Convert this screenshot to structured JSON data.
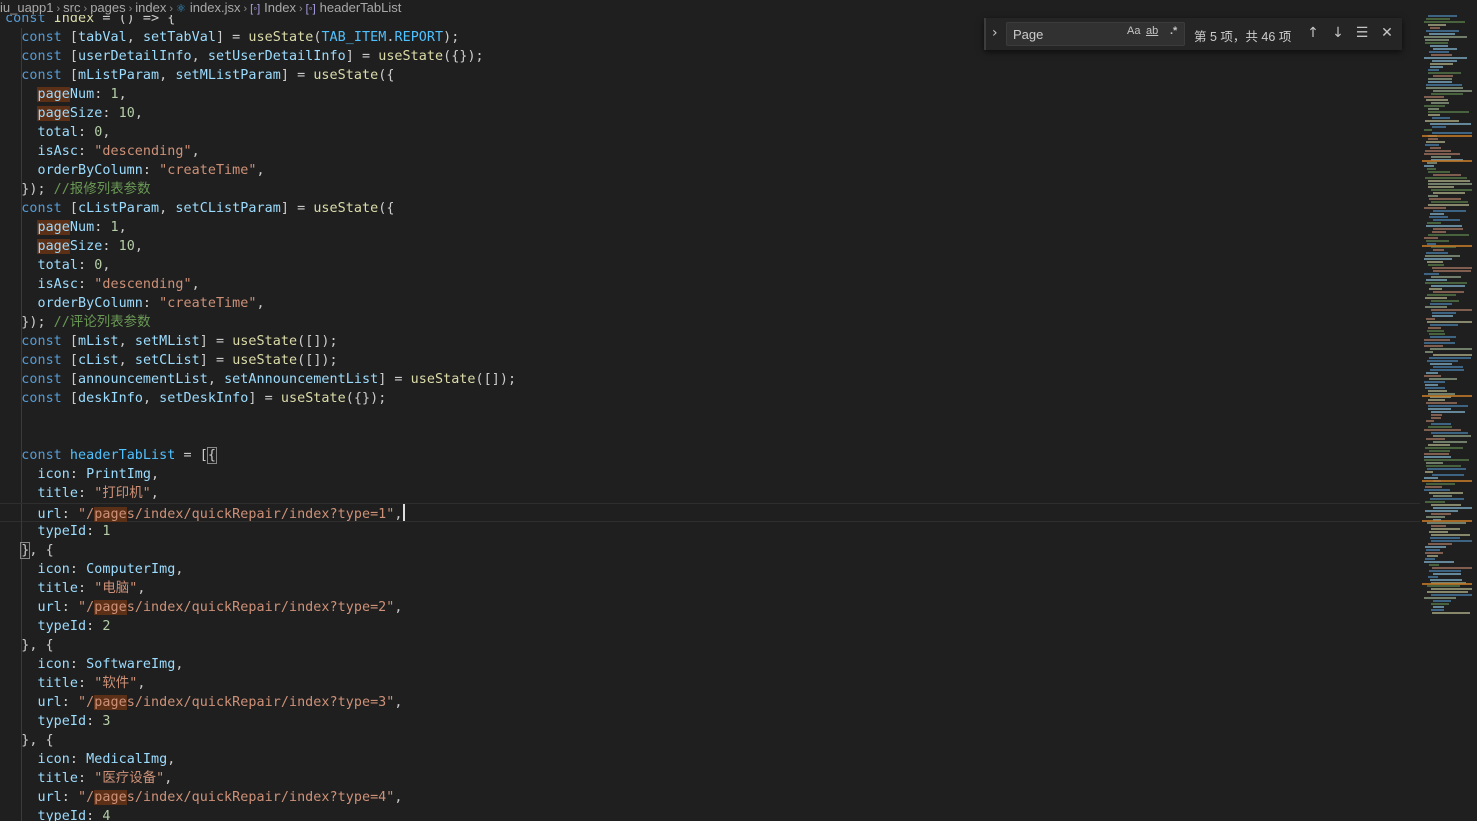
{
  "breadcrumb": {
    "items": [
      "iu_uapp1",
      "src",
      "pages",
      "index",
      "index.jsx",
      "Index",
      "headerTabList"
    ]
  },
  "find_widget": {
    "query": "Page",
    "match_case_label": "Aa",
    "whole_word_label": "ab",
    "regex_label": ".*",
    "count": "第 5 项，共 46 项"
  },
  "colors": {
    "background": "#1f1f1f",
    "keyword": "#569cd6",
    "variable": "#9cdcfe",
    "function": "#dcdcaa",
    "constant": "#4fc1ff",
    "string": "#ce9178",
    "number": "#b5cea8",
    "comment": "#6a9955",
    "match_highlight": "#5c2f17"
  },
  "code": {
    "lines": [
      [
        [
          "k",
          "const "
        ],
        [
          "f",
          "Index"
        ],
        [
          "p",
          " = () => {"
        ]
      ],
      [
        [
          "p",
          "  "
        ],
        [
          "k",
          "const "
        ],
        [
          "p",
          "["
        ],
        [
          "v",
          "tabVal"
        ],
        [
          "p",
          ", "
        ],
        [
          "v",
          "setTabVal"
        ],
        [
          "p",
          "] = "
        ],
        [
          "f",
          "useState"
        ],
        [
          "p",
          "("
        ],
        [
          "c",
          "TAB_ITEM"
        ],
        [
          "p",
          "."
        ],
        [
          "c",
          "REPORT"
        ],
        [
          "p",
          ");"
        ]
      ],
      [
        [
          "p",
          "  "
        ],
        [
          "k",
          "const "
        ],
        [
          "p",
          "["
        ],
        [
          "v",
          "userDetailInfo"
        ],
        [
          "p",
          ", "
        ],
        [
          "v",
          "setUserDetailInfo"
        ],
        [
          "p",
          "] = "
        ],
        [
          "f",
          "useState"
        ],
        [
          "p",
          "({});"
        ]
      ],
      [
        [
          "p",
          "  "
        ],
        [
          "k",
          "const "
        ],
        [
          "p",
          "["
        ],
        [
          "v",
          "mListParam"
        ],
        [
          "p",
          ", "
        ],
        [
          "v",
          "setMListParam"
        ],
        [
          "p",
          "] = "
        ],
        [
          "f",
          "useState"
        ],
        [
          "p",
          "({"
        ]
      ],
      [
        [
          "p",
          "    "
        ],
        [
          "hv",
          "page"
        ],
        [
          "v",
          "Num"
        ],
        [
          "p",
          ": "
        ],
        [
          "n",
          "1"
        ],
        [
          "p",
          ","
        ]
      ],
      [
        [
          "p",
          "    "
        ],
        [
          "hv",
          "page"
        ],
        [
          "v",
          "Size"
        ],
        [
          "p",
          ": "
        ],
        [
          "n",
          "10"
        ],
        [
          "p",
          ","
        ]
      ],
      [
        [
          "p",
          "    "
        ],
        [
          "v",
          "total"
        ],
        [
          "p",
          ": "
        ],
        [
          "n",
          "0"
        ],
        [
          "p",
          ","
        ]
      ],
      [
        [
          "p",
          "    "
        ],
        [
          "v",
          "isAsc"
        ],
        [
          "p",
          ": "
        ],
        [
          "s",
          "\"descending\""
        ],
        [
          "p",
          ","
        ]
      ],
      [
        [
          "p",
          "    "
        ],
        [
          "v",
          "orderByColumn"
        ],
        [
          "p",
          ": "
        ],
        [
          "s",
          "\"createTime\""
        ],
        [
          "p",
          ","
        ]
      ],
      [
        [
          "p",
          "  }); "
        ],
        [
          "cm",
          "//报修列表参数"
        ]
      ],
      [
        [
          "p",
          "  "
        ],
        [
          "k",
          "const "
        ],
        [
          "p",
          "["
        ],
        [
          "v",
          "cListParam"
        ],
        [
          "p",
          ", "
        ],
        [
          "v",
          "setCListParam"
        ],
        [
          "p",
          "] = "
        ],
        [
          "f",
          "useState"
        ],
        [
          "p",
          "({"
        ]
      ],
      [
        [
          "p",
          "    "
        ],
        [
          "hv",
          "page"
        ],
        [
          "v",
          "Num"
        ],
        [
          "p",
          ": "
        ],
        [
          "n",
          "1"
        ],
        [
          "p",
          ","
        ]
      ],
      [
        [
          "p",
          "    "
        ],
        [
          "hv",
          "page"
        ],
        [
          "v",
          "Size"
        ],
        [
          "p",
          ": "
        ],
        [
          "n",
          "10"
        ],
        [
          "p",
          ","
        ]
      ],
      [
        [
          "p",
          "    "
        ],
        [
          "v",
          "total"
        ],
        [
          "p",
          ": "
        ],
        [
          "n",
          "0"
        ],
        [
          "p",
          ","
        ]
      ],
      [
        [
          "p",
          "    "
        ],
        [
          "v",
          "isAsc"
        ],
        [
          "p",
          ": "
        ],
        [
          "s",
          "\"descending\""
        ],
        [
          "p",
          ","
        ]
      ],
      [
        [
          "p",
          "    "
        ],
        [
          "v",
          "orderByColumn"
        ],
        [
          "p",
          ": "
        ],
        [
          "s",
          "\"createTime\""
        ],
        [
          "p",
          ","
        ]
      ],
      [
        [
          "p",
          "  }); "
        ],
        [
          "cm",
          "//评论列表参数"
        ]
      ],
      [
        [
          "p",
          "  "
        ],
        [
          "k",
          "const "
        ],
        [
          "p",
          "["
        ],
        [
          "v",
          "mList"
        ],
        [
          "p",
          ", "
        ],
        [
          "v",
          "setMList"
        ],
        [
          "p",
          "] = "
        ],
        [
          "f",
          "useState"
        ],
        [
          "p",
          "([]);"
        ]
      ],
      [
        [
          "p",
          "  "
        ],
        [
          "k",
          "const "
        ],
        [
          "p",
          "["
        ],
        [
          "v",
          "cList"
        ],
        [
          "p",
          ", "
        ],
        [
          "v",
          "setCList"
        ],
        [
          "p",
          "] = "
        ],
        [
          "f",
          "useState"
        ],
        [
          "p",
          "([]);"
        ]
      ],
      [
        [
          "p",
          "  "
        ],
        [
          "k",
          "const "
        ],
        [
          "p",
          "["
        ],
        [
          "v",
          "announcementList"
        ],
        [
          "p",
          ", "
        ],
        [
          "v",
          "setAnnouncementList"
        ],
        [
          "p",
          "] = "
        ],
        [
          "f",
          "useState"
        ],
        [
          "p",
          "([]);"
        ]
      ],
      [
        [
          "p",
          "  "
        ],
        [
          "k",
          "const "
        ],
        [
          "p",
          "["
        ],
        [
          "v",
          "deskInfo"
        ],
        [
          "p",
          ", "
        ],
        [
          "v",
          "setDeskInfo"
        ],
        [
          "p",
          "] = "
        ],
        [
          "f",
          "useState"
        ],
        [
          "p",
          "({});"
        ]
      ],
      [],
      [],
      [
        [
          "p",
          "  "
        ],
        [
          "k",
          "const "
        ],
        [
          "c",
          "headerTabList"
        ],
        [
          "p",
          " = ["
        ],
        [
          "bp",
          "{"
        ]
      ],
      [
        [
          "p",
          "    "
        ],
        [
          "v",
          "icon"
        ],
        [
          "p",
          ": "
        ],
        [
          "v",
          "PrintImg"
        ],
        [
          "p",
          ","
        ]
      ],
      [
        [
          "p",
          "    "
        ],
        [
          "v",
          "title"
        ],
        [
          "p",
          ": "
        ],
        [
          "s",
          "\"打印机\""
        ],
        [
          "p",
          ","
        ]
      ],
      [
        [
          "p",
          "    "
        ],
        [
          "v",
          "url"
        ],
        [
          "p",
          ": "
        ],
        [
          "s",
          "\"/"
        ],
        [
          "hs",
          "page"
        ],
        [
          "s",
          "s/index/quickRepair/index?type=1\""
        ],
        [
          "p",
          ","
        ],
        [
          "cur",
          ""
        ]
      ],
      [
        [
          "p",
          "    "
        ],
        [
          "v",
          "typeId"
        ],
        [
          "p",
          ": "
        ],
        [
          "n",
          "1"
        ]
      ],
      [
        [
          "p",
          "  "
        ],
        [
          "bp",
          "}"
        ],
        [
          "p",
          ", {"
        ]
      ],
      [
        [
          "p",
          "    "
        ],
        [
          "v",
          "icon"
        ],
        [
          "p",
          ": "
        ],
        [
          "v",
          "ComputerImg"
        ],
        [
          "p",
          ","
        ]
      ],
      [
        [
          "p",
          "    "
        ],
        [
          "v",
          "title"
        ],
        [
          "p",
          ": "
        ],
        [
          "s",
          "\"电脑\""
        ],
        [
          "p",
          ","
        ]
      ],
      [
        [
          "p",
          "    "
        ],
        [
          "v",
          "url"
        ],
        [
          "p",
          ": "
        ],
        [
          "s",
          "\"/"
        ],
        [
          "hs",
          "page"
        ],
        [
          "s",
          "s/index/quickRepair/index?type=2\""
        ],
        [
          "p",
          ","
        ]
      ],
      [
        [
          "p",
          "    "
        ],
        [
          "v",
          "typeId"
        ],
        [
          "p",
          ": "
        ],
        [
          "n",
          "2"
        ]
      ],
      [
        [
          "p",
          "  }, {"
        ]
      ],
      [
        [
          "p",
          "    "
        ],
        [
          "v",
          "icon"
        ],
        [
          "p",
          ": "
        ],
        [
          "v",
          "SoftwareImg"
        ],
        [
          "p",
          ","
        ]
      ],
      [
        [
          "p",
          "    "
        ],
        [
          "v",
          "title"
        ],
        [
          "p",
          ": "
        ],
        [
          "s",
          "\"软件\""
        ],
        [
          "p",
          ","
        ]
      ],
      [
        [
          "p",
          "    "
        ],
        [
          "v",
          "url"
        ],
        [
          "p",
          ": "
        ],
        [
          "s",
          "\"/"
        ],
        [
          "hs",
          "page"
        ],
        [
          "s",
          "s/index/quickRepair/index?type=3\""
        ],
        [
          "p",
          ","
        ]
      ],
      [
        [
          "p",
          "    "
        ],
        [
          "v",
          "typeId"
        ],
        [
          "p",
          ": "
        ],
        [
          "n",
          "3"
        ]
      ],
      [
        [
          "p",
          "  }, {"
        ]
      ],
      [
        [
          "p",
          "    "
        ],
        [
          "v",
          "icon"
        ],
        [
          "p",
          ": "
        ],
        [
          "v",
          "MedicalImg"
        ],
        [
          "p",
          ","
        ]
      ],
      [
        [
          "p",
          "    "
        ],
        [
          "v",
          "title"
        ],
        [
          "p",
          ": "
        ],
        [
          "s",
          "\"医疗设备\""
        ],
        [
          "p",
          ","
        ]
      ],
      [
        [
          "p",
          "    "
        ],
        [
          "v",
          "url"
        ],
        [
          "p",
          ": "
        ],
        [
          "s",
          "\"/"
        ],
        [
          "hs",
          "page"
        ],
        [
          "s",
          "s/index/quickRepair/index?type=4\""
        ],
        [
          "p",
          ","
        ]
      ],
      [
        [
          "p",
          "    "
        ],
        [
          "v",
          "typeId"
        ],
        [
          "p",
          ": "
        ],
        [
          "n",
          "4"
        ]
      ]
    ]
  }
}
